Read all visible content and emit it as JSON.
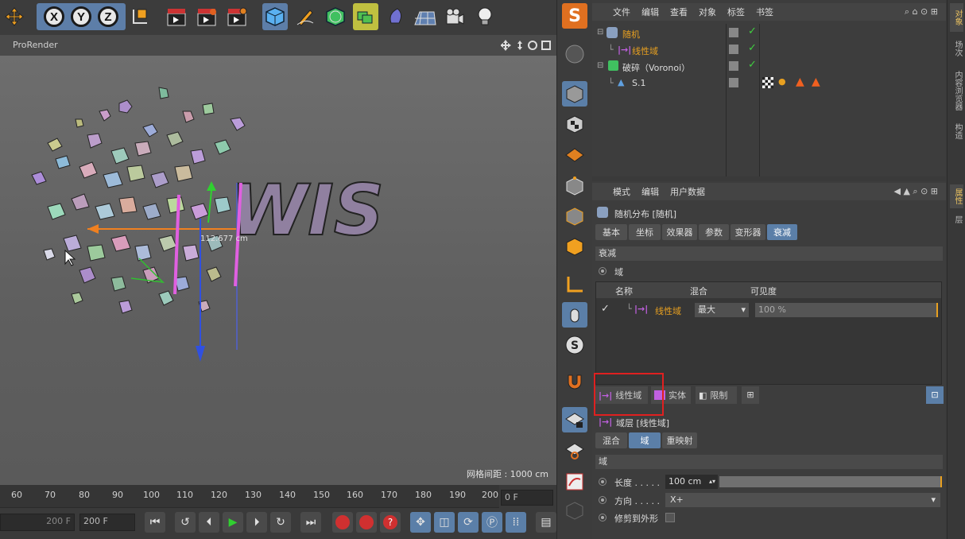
{
  "viewport": {
    "title": "ProRender",
    "measure": "112.677 cm",
    "grid_label": "网格间距 : 1000 cm",
    "text_label": "WIS"
  },
  "toolbar": {
    "axis_x": "X",
    "axis_y": "Y",
    "axis_z": "Z"
  },
  "objects_panel": {
    "menu": [
      "文件",
      "编辑",
      "查看",
      "对象",
      "标签",
      "书签"
    ],
    "tree": [
      {
        "name": "随机",
        "level": 0
      },
      {
        "name": "线性域",
        "level": 1
      },
      {
        "name": "破碎（Voronoi）",
        "level": 0
      },
      {
        "name": "S.1",
        "level": 1
      }
    ]
  },
  "attributes_panel": {
    "menu": [
      "模式",
      "编辑",
      "用户数据"
    ],
    "object_title": "随机分布 [随机]",
    "tabs": [
      "基本",
      "坐标",
      "效果器",
      "参数",
      "变形器",
      "衰减"
    ],
    "active_tab": "衰减",
    "section_falloff": "衰减",
    "field_label": "域",
    "table_headers": [
      "名称",
      "混合",
      "可见度"
    ],
    "table_row": {
      "name": "线性域",
      "blend": "最大",
      "visibility": "100 %"
    },
    "add_buttons": [
      "线性域",
      "实体",
      "限制"
    ],
    "layer_title": "域层 [线性域]",
    "sub_tabs": [
      "混合",
      "域",
      "重映射"
    ],
    "active_sub_tab": "域",
    "section_field": "域",
    "params": [
      {
        "label": "长度 . . . . .",
        "value": "100 cm"
      },
      {
        "label": "方向 . . . . .",
        "value": "X+"
      },
      {
        "label": "修剪到外形",
        "value": ""
      }
    ]
  },
  "timeline": {
    "ticks": [
      "60",
      "70",
      "80",
      "90",
      "100",
      "110",
      "120",
      "130",
      "140",
      "150",
      "160",
      "170",
      "180",
      "190",
      "200"
    ],
    "current_frame": "0 F",
    "end_frame_a": "200 F",
    "end_frame_b": "200 F"
  },
  "side_tabs": [
    "对象",
    "场次",
    "内容浏览器",
    "构造",
    "属性",
    "层"
  ],
  "colors": {
    "accent_blue": "#5b7fa8",
    "highlight_orange": "#e8a020",
    "selection_red": "#e02020",
    "field_purple": "#c060e0"
  }
}
